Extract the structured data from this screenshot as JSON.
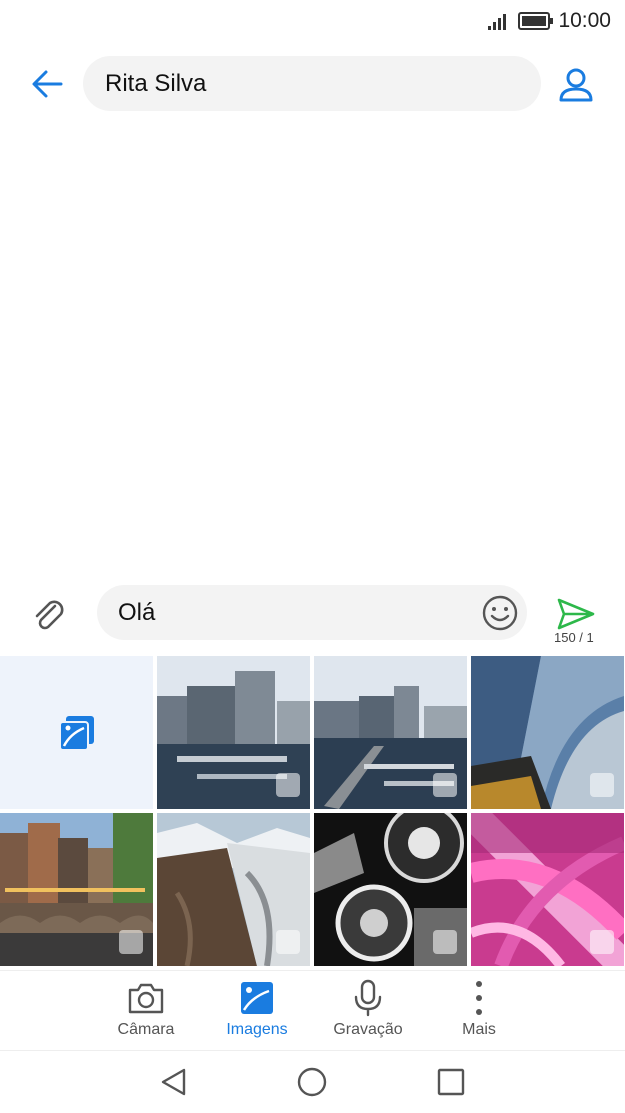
{
  "status_bar": {
    "time": "10:00"
  },
  "header": {
    "recipient": "Rita Silva"
  },
  "compose": {
    "message": "Olá",
    "counter": "150 / 1"
  },
  "gallery": {
    "items": [
      {
        "name": "open-gallery"
      },
      {
        "name": "photo-harbor-buildings-1"
      },
      {
        "name": "photo-harbor-buildings-2"
      },
      {
        "name": "photo-metal-building"
      },
      {
        "name": "photo-amsterdam-canal"
      },
      {
        "name": "photo-glacier-mountains"
      },
      {
        "name": "photo-motorcycle-engine"
      },
      {
        "name": "photo-pink-dandelion"
      }
    ]
  },
  "tabs": [
    {
      "label": "Câmara",
      "icon": "camera-icon"
    },
    {
      "label": "Imagens",
      "icon": "image-icon",
      "active": true
    },
    {
      "label": "Gravação",
      "icon": "microphone-icon"
    },
    {
      "label": "Mais",
      "icon": "more-vertical-icon"
    }
  ],
  "colors": {
    "accent": "#1a7ce0",
    "send": "#2db84a",
    "field_bg": "#f3f3f3"
  }
}
